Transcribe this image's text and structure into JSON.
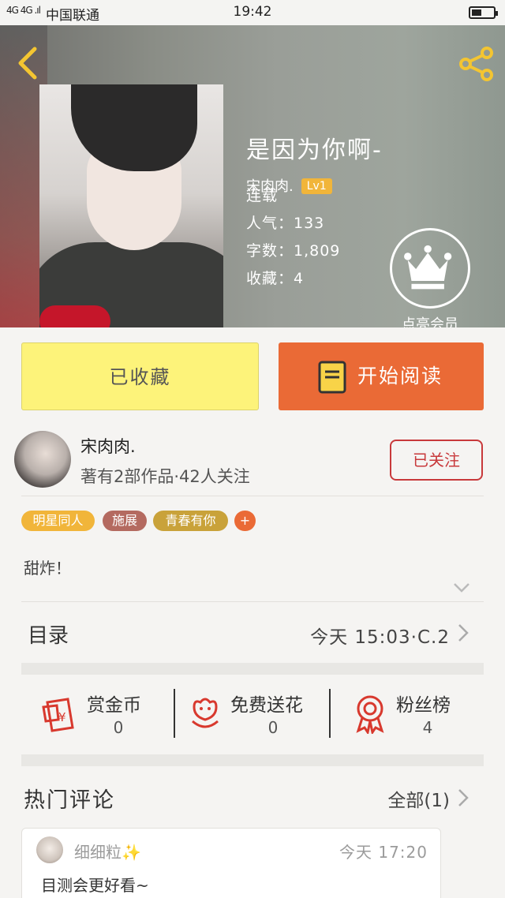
{
  "status_bar": {
    "signal": "4G 4G .ıl",
    "carrier": "中国联通",
    "time": "19:42"
  },
  "book": {
    "title": "是因为你啊-",
    "author": "宋肉肉.",
    "level_badge": "Lv1",
    "status": "连载",
    "popularity": "人气：133",
    "word_count": "字数：1,809",
    "favorites": "收藏：4"
  },
  "vip": {
    "label": "点亮会员",
    "icon": "crown-icon"
  },
  "actions": {
    "favorited_label": "已收藏",
    "read_label": "开始阅读",
    "fav_color": "#fdf37a",
    "read_color": "#ea6a36"
  },
  "writer": {
    "name": "宋肉肉.",
    "stats": "著有2部作品·42人关注",
    "follow_label": "已关注"
  },
  "tags": [
    {
      "label": "明星同人",
      "color": "#f1b53a"
    },
    {
      "label": "施展",
      "color": "#b46a60"
    },
    {
      "label": "青春有你",
      "color": "#c9a23a"
    },
    {
      "label": "+",
      "color": "#ea6a36"
    }
  ],
  "description": "甜炸！",
  "toc": {
    "label": "目录",
    "latest": "今天 15:03·C.2"
  },
  "stats": [
    {
      "label": "赏金币",
      "value": "0",
      "icon": "red-envelope-icon"
    },
    {
      "label": "免费送花",
      "value": "0",
      "icon": "flower-icon"
    },
    {
      "label": "粉丝榜",
      "value": "4",
      "icon": "medal-icon"
    }
  ],
  "hot_comments": {
    "title": "热门评论",
    "all_label": "全部(1)",
    "items": [
      {
        "user": "细细粒",
        "sparkle": "✨",
        "time": "今天 17:20",
        "text": "目测会更好看~"
      }
    ]
  },
  "colors": {
    "accent_red": "#c8393b",
    "accent_orange": "#ea6a36"
  }
}
